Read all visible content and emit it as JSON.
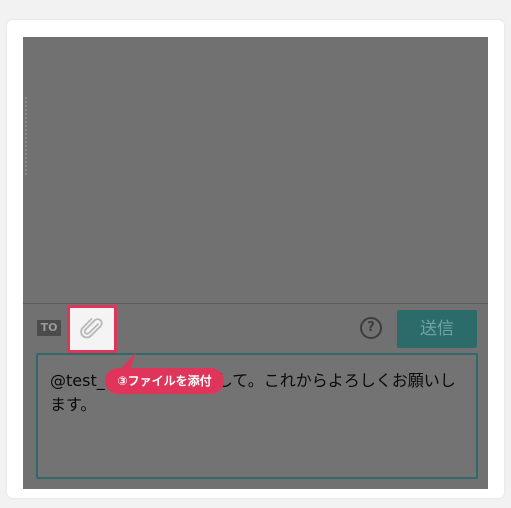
{
  "chatroom": {
    "to_badge": "TO",
    "help_label": "?",
    "send_label": "送信",
    "message_text": "@test_さんへ、初めまして。これからよろしくお願いします。"
  },
  "annotation": {
    "tooltip_label": "③ファイルを添付"
  },
  "colors": {
    "highlight": "#e0355a",
    "send_button": "#2b6b6a",
    "overlay": "#717171"
  },
  "icons": {
    "attach": "paperclip-icon"
  }
}
